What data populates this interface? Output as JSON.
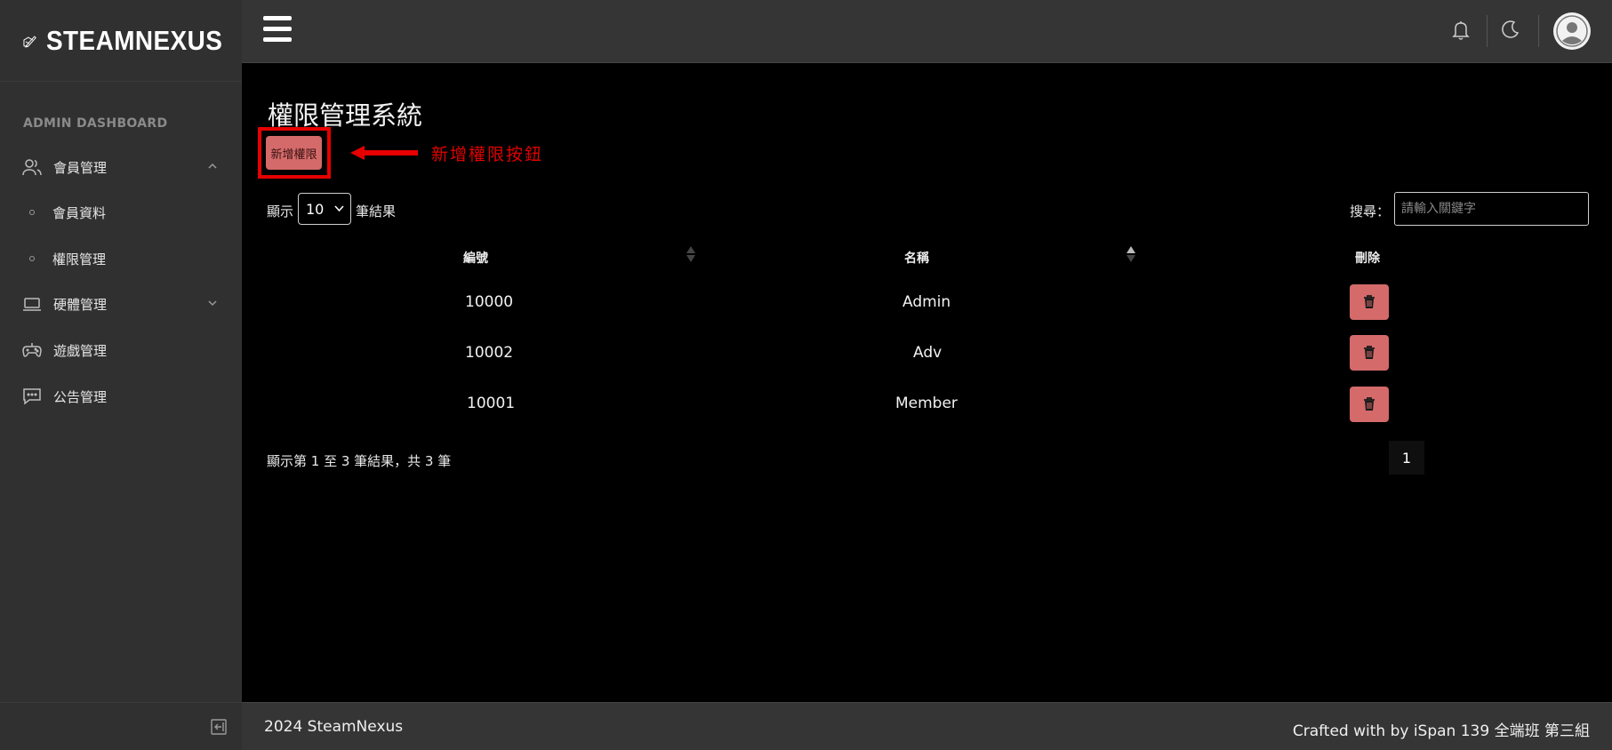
{
  "brand": {
    "name": "STEAMNEXUS",
    "icon": "pencil-cube-icon"
  },
  "sidebar": {
    "section_title": "ADMIN DASHBOARD",
    "items": [
      {
        "label": "會員管理",
        "icon": "users-icon",
        "expanded": true,
        "children": [
          {
            "label": "會員資料"
          },
          {
            "label": "權限管理"
          }
        ]
      },
      {
        "label": "硬體管理",
        "icon": "laptop-icon",
        "expanded": false
      },
      {
        "label": "遊戲管理",
        "icon": "gamepad-icon"
      },
      {
        "label": "公告管理",
        "icon": "chat-icon"
      }
    ]
  },
  "header": {
    "menu_icon": "hamburger-icon",
    "icons": [
      "bell-icon",
      "moon-icon",
      "avatar-icon"
    ]
  },
  "page": {
    "title": "權限管理系統",
    "add_button": "新增權限",
    "annotation": "新增權限按鈕",
    "length": {
      "prefix": "顯示",
      "value": "10",
      "suffix": "筆結果"
    },
    "search": {
      "label": "搜尋：",
      "placeholder": "請輸入關鍵字"
    },
    "table": {
      "columns": [
        "編號",
        "名稱",
        "刪除"
      ],
      "rows": [
        {
          "id": "10000",
          "name": "Admin"
        },
        {
          "id": "10002",
          "name": "Adv"
        },
        {
          "id": "10001",
          "name": "Member"
        }
      ]
    },
    "info": "顯示第 1 至 3 筆結果，共 3 筆",
    "pagination": [
      "1"
    ]
  },
  "footer": {
    "left": "2024 SteamNexus",
    "right": "Crafted with by iSpan 139 全端班 第三組"
  },
  "colors": {
    "accent": "#d46a6a",
    "annotation": "#e00000",
    "sidebar_bg": "#303030",
    "header_bg": "#353535"
  }
}
